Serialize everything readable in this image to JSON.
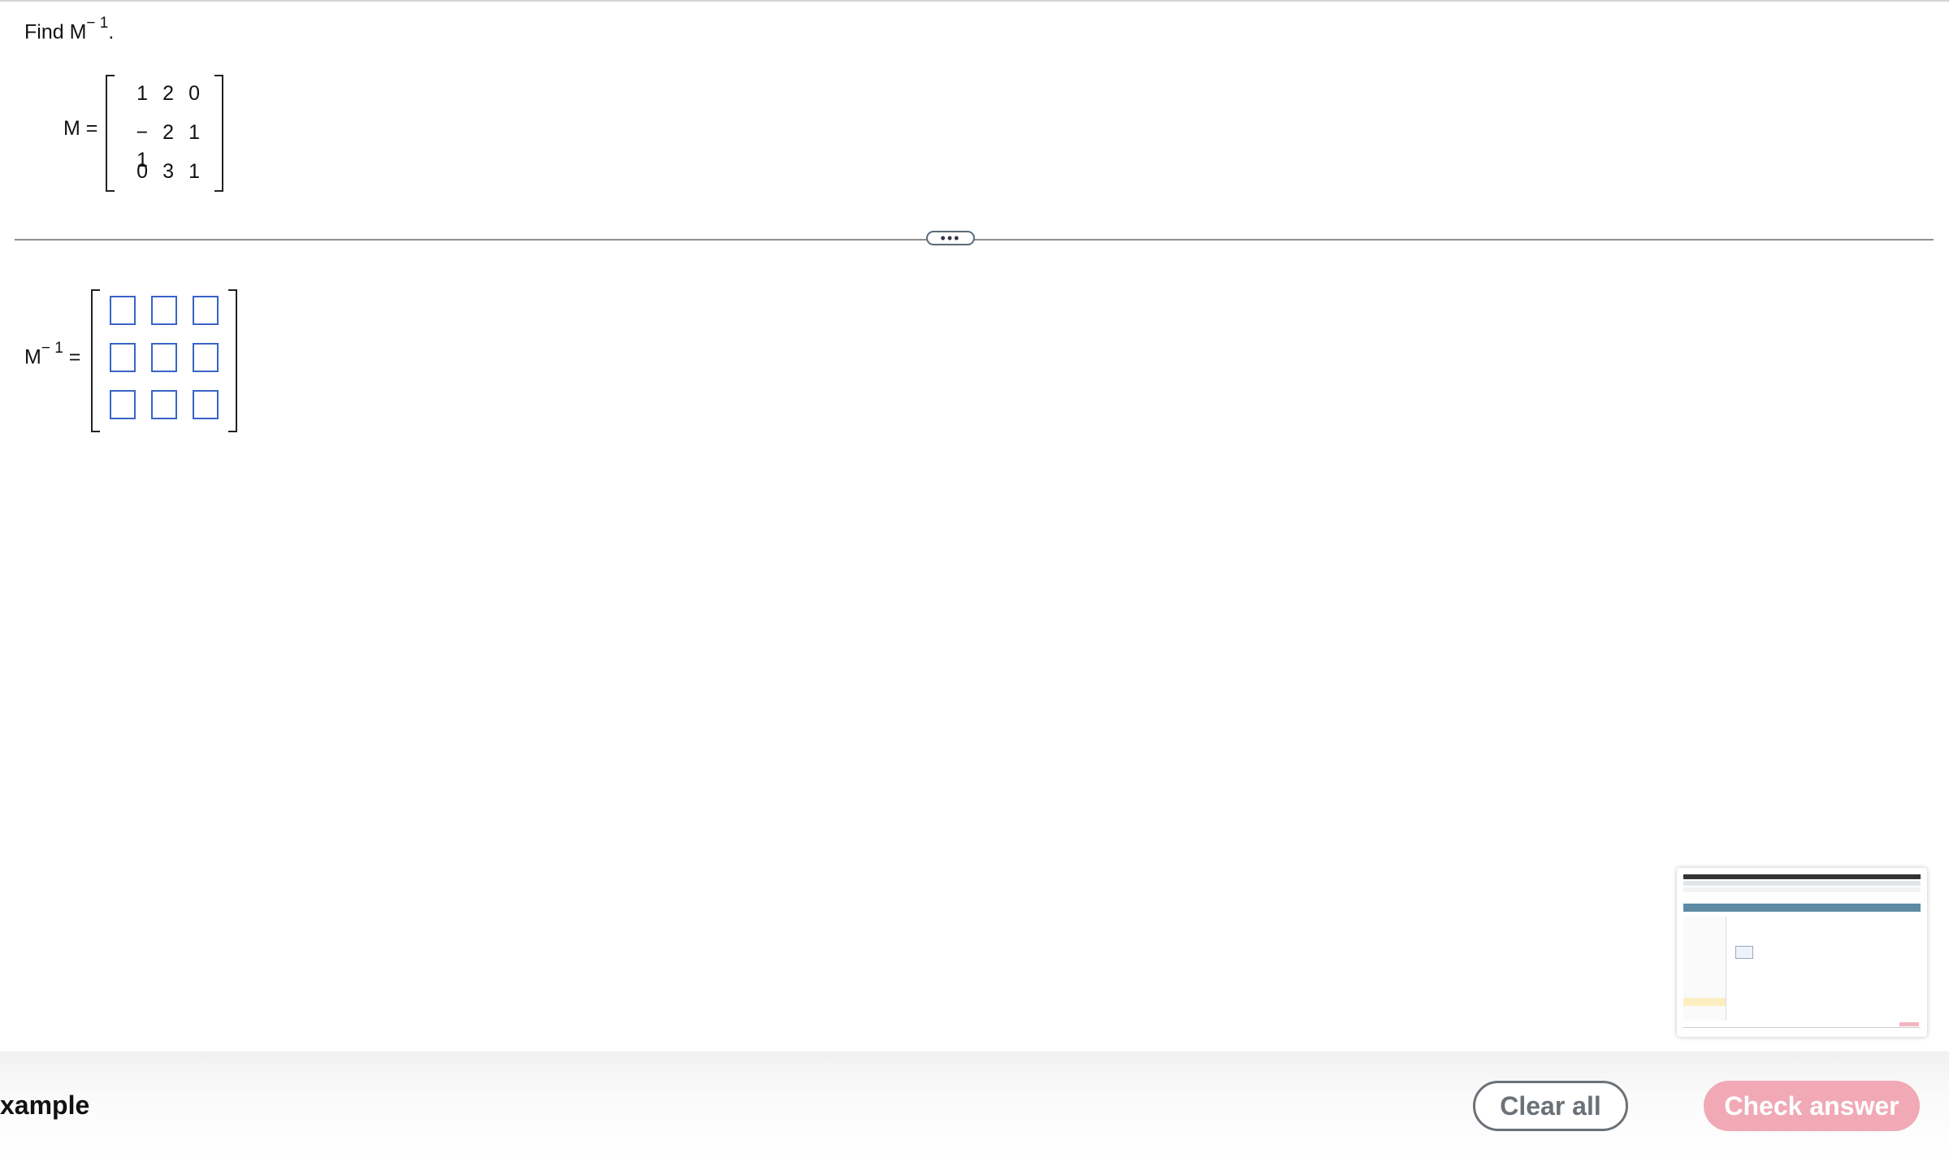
{
  "question": {
    "prefix": "Find M",
    "superscript": "− 1",
    "suffix": "."
  },
  "matrix_m": {
    "label": "M =",
    "rows": [
      [
        "1",
        "2",
        "0"
      ],
      [
        "− 1",
        "2",
        "1"
      ],
      [
        "0",
        "3",
        "1"
      ]
    ]
  },
  "divider": {
    "handle_text": "•••"
  },
  "answer": {
    "label_base": "M",
    "label_superscript": "− 1",
    "label_equals": "=",
    "cells": [
      "",
      "",
      "",
      "",
      "",
      "",
      "",
      "",
      ""
    ]
  },
  "footer": {
    "left_label": "xample",
    "clear_label": "Clear all",
    "check_label": "Check answer"
  },
  "colors": {
    "input_border": "#3a63c7",
    "check_button_bg": "#f1a9b6",
    "clear_button_border": "#6b7177"
  }
}
